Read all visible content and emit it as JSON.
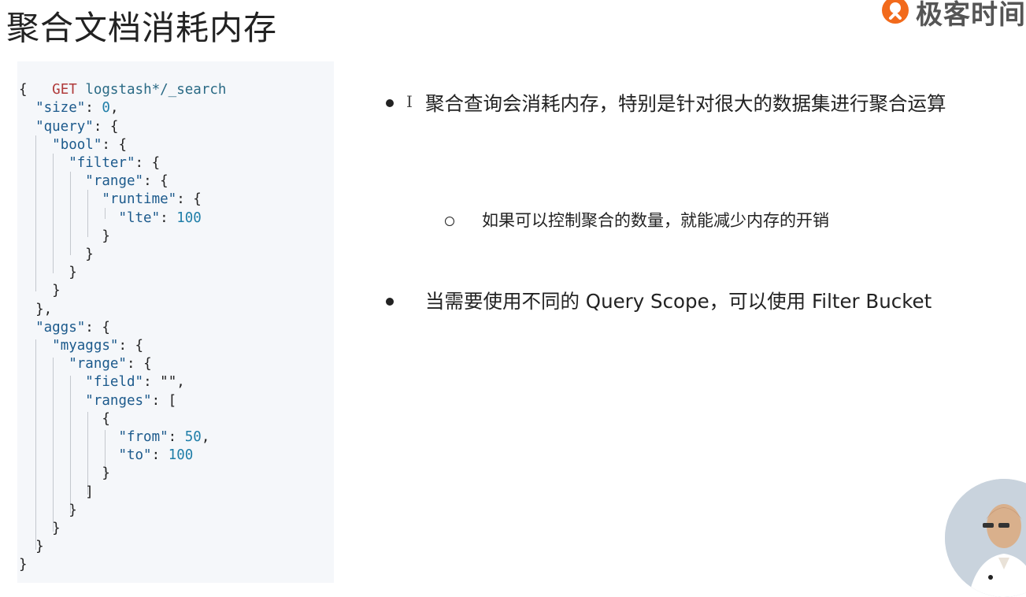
{
  "slide": {
    "title": "聚合文档消耗内存"
  },
  "logo": {
    "text": "极客时间",
    "icon": "geektime-logo-icon",
    "color": "#f26a1b"
  },
  "code": {
    "request_method": "GET",
    "request_path": "logstash*/_search",
    "lines": [
      "{",
      "  \"size\": 0,",
      "  \"query\": {",
      "    \"bool\": {",
      "      \"filter\": {",
      "        \"range\": {",
      "          \"runtime\": {",
      "            \"lte\": 100",
      "          }",
      "        }",
      "      }",
      "    }",
      "  },",
      "  \"aggs\": {",
      "    \"myaggs\": {",
      "      \"range\": {",
      "        \"field\": \"\",",
      "        \"ranges\": [",
      "          {",
      "            \"from\": 50,",
      "            \"to\": 100",
      "          }",
      "        ]",
      "      }",
      "    }",
      "  }",
      "}"
    ]
  },
  "bullets": [
    {
      "text": "聚合查询会消耗内存，特别是针对很大的数据集进行聚合运算"
    },
    {
      "text": "当需要使用不同的 Query Scope，可以使用 Filter Bucket"
    }
  ],
  "sub_bullets": [
    {
      "text": "如果可以控制聚合的数量，就能减少内存的开销"
    }
  ],
  "cursor_icon": "text-cursor-icon",
  "presenter_icon": "presenter-video-thumbnail"
}
